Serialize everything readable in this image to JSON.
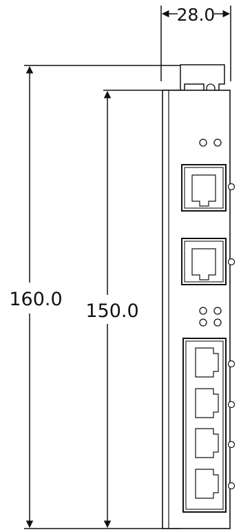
{
  "dimensions": {
    "width_label": "28.0",
    "total_height_label": "160.0",
    "body_height_label": "150.0"
  },
  "device": {
    "top_led_count": 2,
    "single_ports": 2,
    "middle_led_count": 4,
    "port_stack_count": 4
  },
  "colors": {
    "line": "#111111",
    "background": "#ffffff"
  }
}
